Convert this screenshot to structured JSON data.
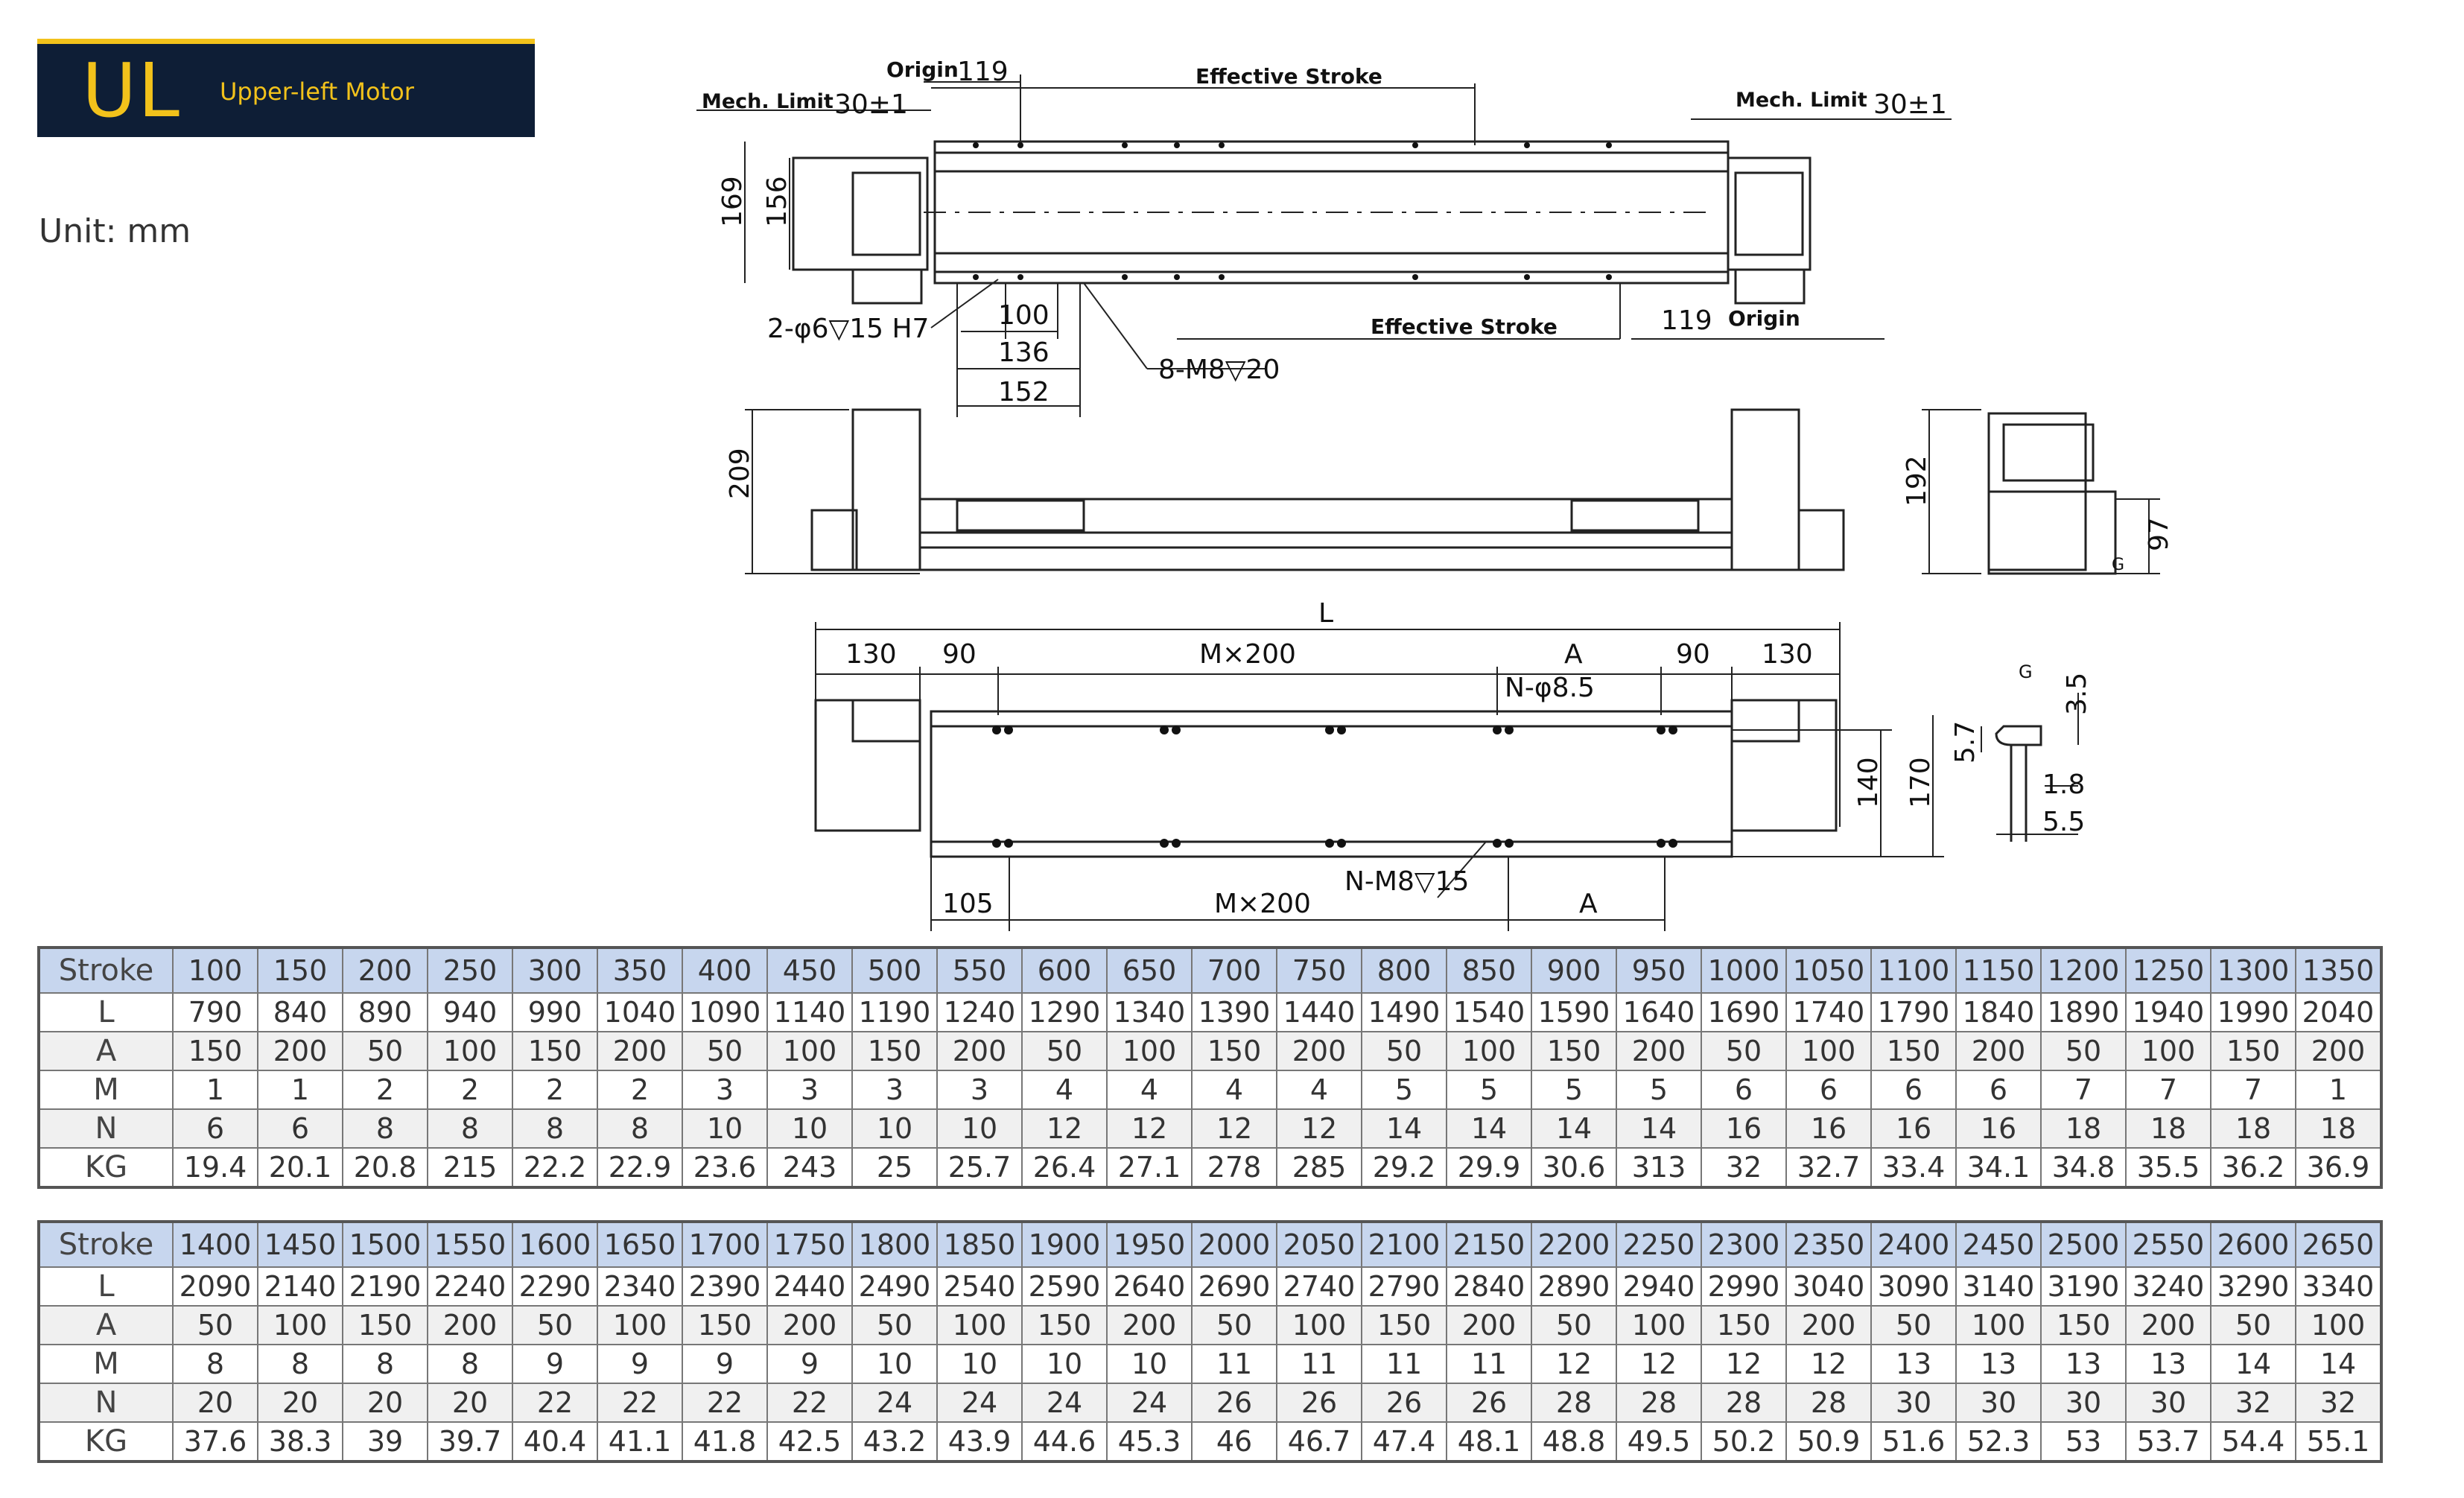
{
  "header": {
    "code": "UL",
    "subtitle": "Upper-left Motor"
  },
  "unit_label": "Unit: mm",
  "drawing_labels": {
    "origin": "Origin",
    "mech_limit": "Mech. Limit",
    "effective_stroke": "Effective Stroke",
    "dim_119": "119",
    "dim_30": "30±1",
    "dim_169": "169",
    "dim_156": "156",
    "hole_pin": "2-φ6▽15 H7",
    "hole_m8": "8-M8▽20",
    "dim_100": "100",
    "dim_136": "136",
    "dim_152": "152",
    "dim_209": "209",
    "dim_192": "192",
    "dim_97": "97",
    "g": "G",
    "L": "L",
    "dim_130": "130",
    "dim_90": "90",
    "m200": "M×200",
    "A": "A",
    "n_hole": "N-φ8.5",
    "n_m8": "N-M8▽15",
    "dim_105": "105",
    "dim_140": "140",
    "dim_170": "170",
    "dim_57": "5.7",
    "dim_35": "3.5",
    "dim_18": "1.8",
    "dim_55": "5.5"
  },
  "tables": [
    {
      "rows": [
        {
          "label": "Stroke",
          "values": [
            "100",
            "150",
            "200",
            "250",
            "300",
            "350",
            "400",
            "450",
            "500",
            "550",
            "600",
            "650",
            "700",
            "750",
            "800",
            "850",
            "900",
            "950",
            "1000",
            "1050",
            "1100",
            "1150",
            "1200",
            "1250",
            "1300",
            "1350"
          ]
        },
        {
          "label": "L",
          "values": [
            "790",
            "840",
            "890",
            "940",
            "990",
            "1040",
            "1090",
            "1140",
            "1190",
            "1240",
            "1290",
            "1340",
            "1390",
            "1440",
            "1490",
            "1540",
            "1590",
            "1640",
            "1690",
            "1740",
            "1790",
            "1840",
            "1890",
            "1940",
            "1990",
            "2040"
          ]
        },
        {
          "label": "A",
          "values": [
            "150",
            "200",
            "50",
            "100",
            "150",
            "200",
            "50",
            "100",
            "150",
            "200",
            "50",
            "100",
            "150",
            "200",
            "50",
            "100",
            "150",
            "200",
            "50",
            "100",
            "150",
            "200",
            "50",
            "100",
            "150",
            "200"
          ]
        },
        {
          "label": "M",
          "values": [
            "1",
            "1",
            "2",
            "2",
            "2",
            "2",
            "3",
            "3",
            "3",
            "3",
            "4",
            "4",
            "4",
            "4",
            "5",
            "5",
            "5",
            "5",
            "6",
            "6",
            "6",
            "6",
            "7",
            "7",
            "7",
            "1"
          ]
        },
        {
          "label": "N",
          "values": [
            "6",
            "6",
            "8",
            "8",
            "8",
            "8",
            "10",
            "10",
            "10",
            "10",
            "12",
            "12",
            "12",
            "12",
            "14",
            "14",
            "14",
            "14",
            "16",
            "16",
            "16",
            "16",
            "18",
            "18",
            "18",
            "18"
          ]
        },
        {
          "label": "KG",
          "values": [
            "19.4",
            "20.1",
            "20.8",
            "215",
            "22.2",
            "22.9",
            "23.6",
            "243",
            "25",
            "25.7",
            "26.4",
            "27.1",
            "278",
            "285",
            "29.2",
            "29.9",
            "30.6",
            "313",
            "32",
            "32.7",
            "33.4",
            "34.1",
            "34.8",
            "35.5",
            "36.2",
            "36.9"
          ]
        }
      ]
    },
    {
      "rows": [
        {
          "label": "Stroke",
          "values": [
            "1400",
            "1450",
            "1500",
            "1550",
            "1600",
            "1650",
            "1700",
            "1750",
            "1800",
            "1850",
            "1900",
            "1950",
            "2000",
            "2050",
            "2100",
            "2150",
            "2200",
            "2250",
            "2300",
            "2350",
            "2400",
            "2450",
            "2500",
            "2550",
            "2600",
            "2650"
          ]
        },
        {
          "label": "L",
          "values": [
            "2090",
            "2140",
            "2190",
            "2240",
            "2290",
            "2340",
            "2390",
            "2440",
            "2490",
            "2540",
            "2590",
            "2640",
            "2690",
            "2740",
            "2790",
            "2840",
            "2890",
            "2940",
            "2990",
            "3040",
            "3090",
            "3140",
            "3190",
            "3240",
            "3290",
            "3340"
          ]
        },
        {
          "label": "A",
          "values": [
            "50",
            "100",
            "150",
            "200",
            "50",
            "100",
            "150",
            "200",
            "50",
            "100",
            "150",
            "200",
            "50",
            "100",
            "150",
            "200",
            "50",
            "100",
            "150",
            "200",
            "50",
            "100",
            "150",
            "200",
            "50",
            "100"
          ]
        },
        {
          "label": "M",
          "values": [
            "8",
            "8",
            "8",
            "8",
            "9",
            "9",
            "9",
            "9",
            "10",
            "10",
            "10",
            "10",
            "11",
            "11",
            "11",
            "11",
            "12",
            "12",
            "12",
            "12",
            "13",
            "13",
            "13",
            "13",
            "14",
            "14"
          ]
        },
        {
          "label": "N",
          "values": [
            "20",
            "20",
            "20",
            "20",
            "22",
            "22",
            "22",
            "22",
            "24",
            "24",
            "24",
            "24",
            "26",
            "26",
            "26",
            "26",
            "28",
            "28",
            "28",
            "28",
            "30",
            "30",
            "30",
            "30",
            "32",
            "32"
          ]
        },
        {
          "label": "KG",
          "values": [
            "37.6",
            "38.3",
            "39",
            "39.7",
            "40.4",
            "41.1",
            "41.8",
            "42.5",
            "43.2",
            "43.9",
            "44.6",
            "45.3",
            "46",
            "46.7",
            "47.4",
            "48.1",
            "48.8",
            "49.5",
            "50.2",
            "50.9",
            "51.6",
            "52.3",
            "53",
            "53.7",
            "54.4",
            "55.1"
          ]
        }
      ]
    }
  ]
}
